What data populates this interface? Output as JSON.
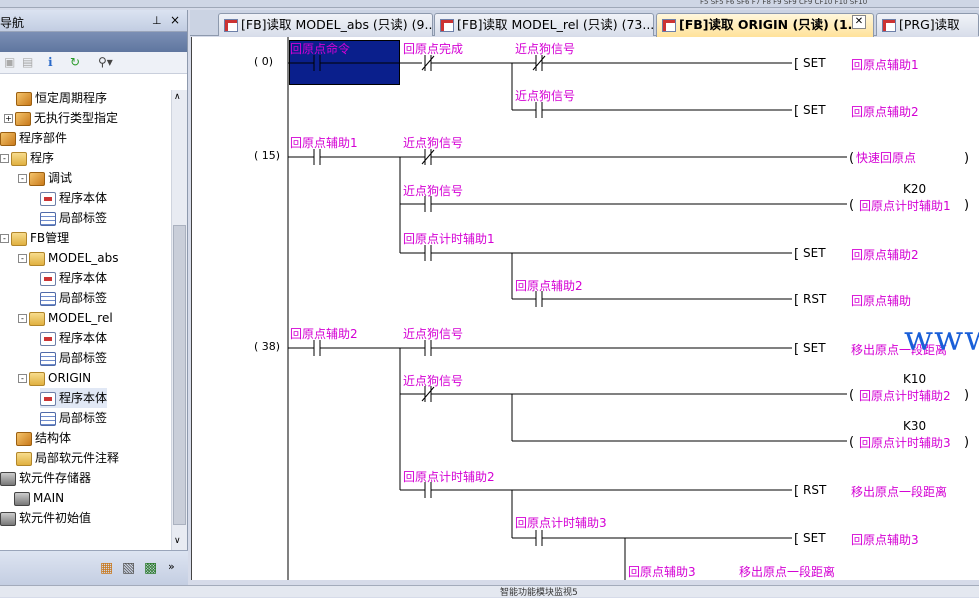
{
  "nav": {
    "title": "导航",
    "pin": "ᵖ",
    "close": "×"
  },
  "tree": [
    {
      "label": "恒定周期程序",
      "icon": "program-icon",
      "exp": ""
    },
    {
      "label": "无执行类型指定",
      "icon": "program-icon",
      "exp": "+"
    },
    {
      "label": "程序部件",
      "icon": "program-icon",
      "exp": ""
    },
    {
      "label": "程序",
      "icon": "folder-icon",
      "exp": "-"
    },
    {
      "label": "调试",
      "icon": "program-icon",
      "exp": "-"
    },
    {
      "label": "程序本体",
      "icon": "ladder-doc-icon",
      "exp": ""
    },
    {
      "label": "局部标签",
      "icon": "label-table-icon",
      "exp": ""
    },
    {
      "label": "FB管理",
      "icon": "folder-icon",
      "exp": "-"
    },
    {
      "label": "MODEL_abs",
      "icon": "folder-icon",
      "exp": "-"
    },
    {
      "label": "程序本体",
      "icon": "ladder-doc-icon",
      "exp": ""
    },
    {
      "label": "局部标签",
      "icon": "label-table-icon",
      "exp": ""
    },
    {
      "label": "MODEL_rel",
      "icon": "folder-icon",
      "exp": "-"
    },
    {
      "label": "程序本体",
      "icon": "ladder-doc-icon",
      "exp": ""
    },
    {
      "label": "局部标签",
      "icon": "label-table-icon",
      "exp": ""
    },
    {
      "label": "ORIGIN",
      "icon": "folder-icon",
      "exp": "-"
    },
    {
      "label": "程序本体",
      "icon": "ladder-doc-icon",
      "exp": ""
    },
    {
      "label": "局部标签",
      "icon": "label-table-icon",
      "exp": ""
    },
    {
      "label": "结构体",
      "icon": "program-icon",
      "exp": ""
    },
    {
      "label": "局部软元件注释",
      "icon": "folder-icon",
      "exp": ""
    },
    {
      "label": "软元件存储器",
      "icon": "device-icon",
      "exp": ""
    },
    {
      "label": "MAIN",
      "icon": "device-icon",
      "exp": ""
    },
    {
      "label": "软元件初始值",
      "icon": "device-icon",
      "exp": ""
    }
  ],
  "tabs": [
    {
      "label": "[FB]读取 MODEL_abs (只读) (9..."
    },
    {
      "label": "[FB]读取 MODEL_rel (只读) (73..."
    },
    {
      "label": "[FB]读取 ORIGIN (只读) (1..."
    },
    {
      "label": "[PRG]读取"
    }
  ],
  "steps": [
    "(      0)",
    "(     15)",
    "(     38)"
  ],
  "ladder": {
    "r0_c1": "回原点命令",
    "r0_c2": "回原点完成",
    "r0_c3": "近点狗信号",
    "r0_set": "SET",
    "r0_out": "回原点辅助1",
    "r1_c3": "近点狗信号",
    "r1_set": "SET",
    "r1_out": "回原点辅助2",
    "r2_c1": "回原点辅助1",
    "r2_c2": "近点狗信号",
    "r2_out": "快速回原点",
    "r3_c2": "近点狗信号",
    "r3_k": "K20",
    "r3_out": "回原点计时辅助1",
    "r4_c2": "回原点计时辅助1",
    "r4_set": "SET",
    "r4_out": "回原点辅助2",
    "r5_c3": "回原点辅助2",
    "r5_rst": "RST",
    "r5_out": "回原点辅助",
    "r6_c1": "回原点辅助2",
    "r6_c2": "近点狗信号",
    "r6_set": "SET",
    "r6_out": "移出原点一段距离",
    "r7_c2": "近点狗信号",
    "r7_k": "K10",
    "r7_out": "回原点计时辅助2",
    "r8_k": "K30",
    "r8_out": "回原点计时辅助3",
    "r9_c2": "回原点计时辅助2",
    "r9_rst": "RST",
    "r9_out": "移出原点一段距离",
    "r10_c3": "回原点计时辅助3",
    "r10_set": "SET",
    "r10_out": "回原点辅助3",
    "r11_a": "回原点辅助3",
    "r11_b": "移出原点一段距离"
  },
  "watermark": "www.eleok.com",
  "status": {
    "left": "",
    "right": "智能功能模块监视5"
  },
  "colors": {
    "label": "#d400d4",
    "selection": "#0a1f8c",
    "watermark": "#1a5fd8",
    "tab_active": "#ffe29a"
  }
}
